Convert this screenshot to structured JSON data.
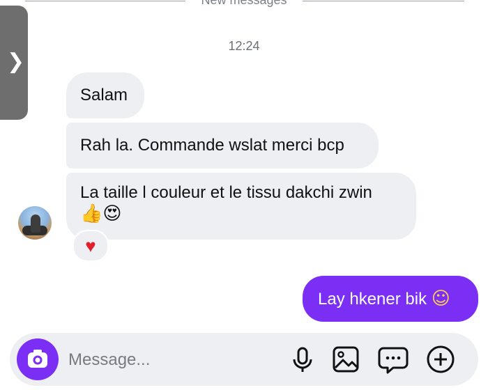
{
  "divider": {
    "label": "New messages"
  },
  "thread": {
    "timestamp": "12:24",
    "incoming": [
      {
        "text": "Salam"
      },
      {
        "text": "Rah la. Commande wslat merci bcp"
      },
      {
        "text": "La taille l couleur et le tissu dakchi zwin",
        "emoji": "👍😍",
        "reaction": "♥"
      }
    ],
    "outgoing": [
      {
        "text": "Lay hkener bik",
        "emoji": "☺"
      }
    ]
  },
  "composer": {
    "placeholder": "Message..."
  },
  "colors": {
    "accent": "#7b2ff5",
    "incoming_bubble": "#eeeff2",
    "reaction_heart": "#e0202f"
  },
  "icons": [
    "chevron-right-icon",
    "camera-icon",
    "microphone-icon",
    "image-icon",
    "sticker-chat-icon",
    "plus-icon"
  ]
}
